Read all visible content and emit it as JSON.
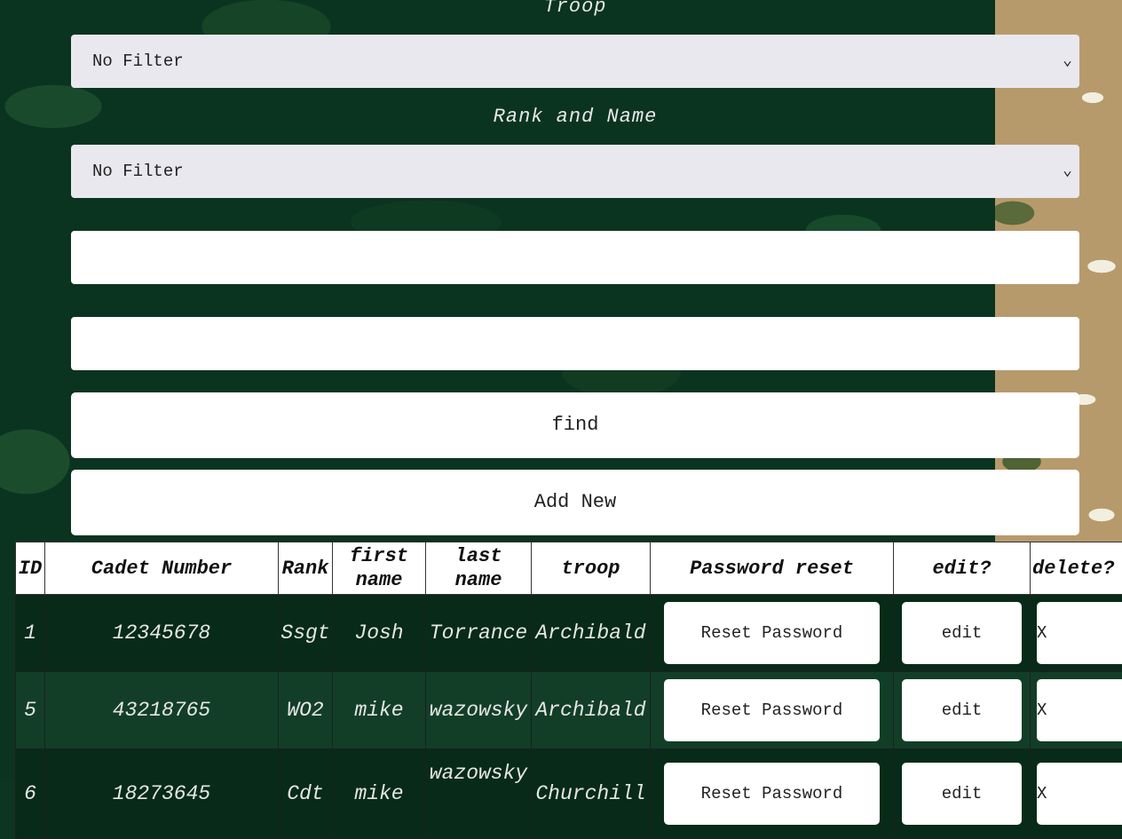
{
  "filters": {
    "troop_label": "Troop",
    "troop_value": "No Filter",
    "rank_label": "Rank and Name",
    "rank_value": "No Filter",
    "input1_value": "",
    "input2_value": ""
  },
  "buttons": {
    "find": "find",
    "add_new": "Add New"
  },
  "table": {
    "headers": [
      "ID",
      "Cadet Number",
      "Rank",
      "first name",
      "last name",
      "troop",
      "Password reset",
      "edit?",
      "delete?"
    ],
    "rows": [
      {
        "id": "1",
        "cadet_number": "12345678",
        "rank": "Ssgt",
        "first_name": "Josh",
        "last_name": "Torrance",
        "troop": "Archibald",
        "reset": "Reset Password",
        "edit": "edit",
        "delete": "X"
      },
      {
        "id": "5",
        "cadet_number": "43218765",
        "rank": "WO2",
        "first_name": "mike",
        "last_name": "wazowsky",
        "troop": "Archibald",
        "reset": "Reset Password",
        "edit": "edit",
        "delete": "X"
      },
      {
        "id": "6",
        "cadet_number": "18273645",
        "rank": "Cdt",
        "first_name": "mike",
        "last_name": "wazowsky",
        "troop": "Churchill",
        "reset": "Reset Password",
        "edit": "edit",
        "delete": "X"
      }
    ]
  },
  "icons": {
    "chevron": "chevron-down-icon"
  }
}
